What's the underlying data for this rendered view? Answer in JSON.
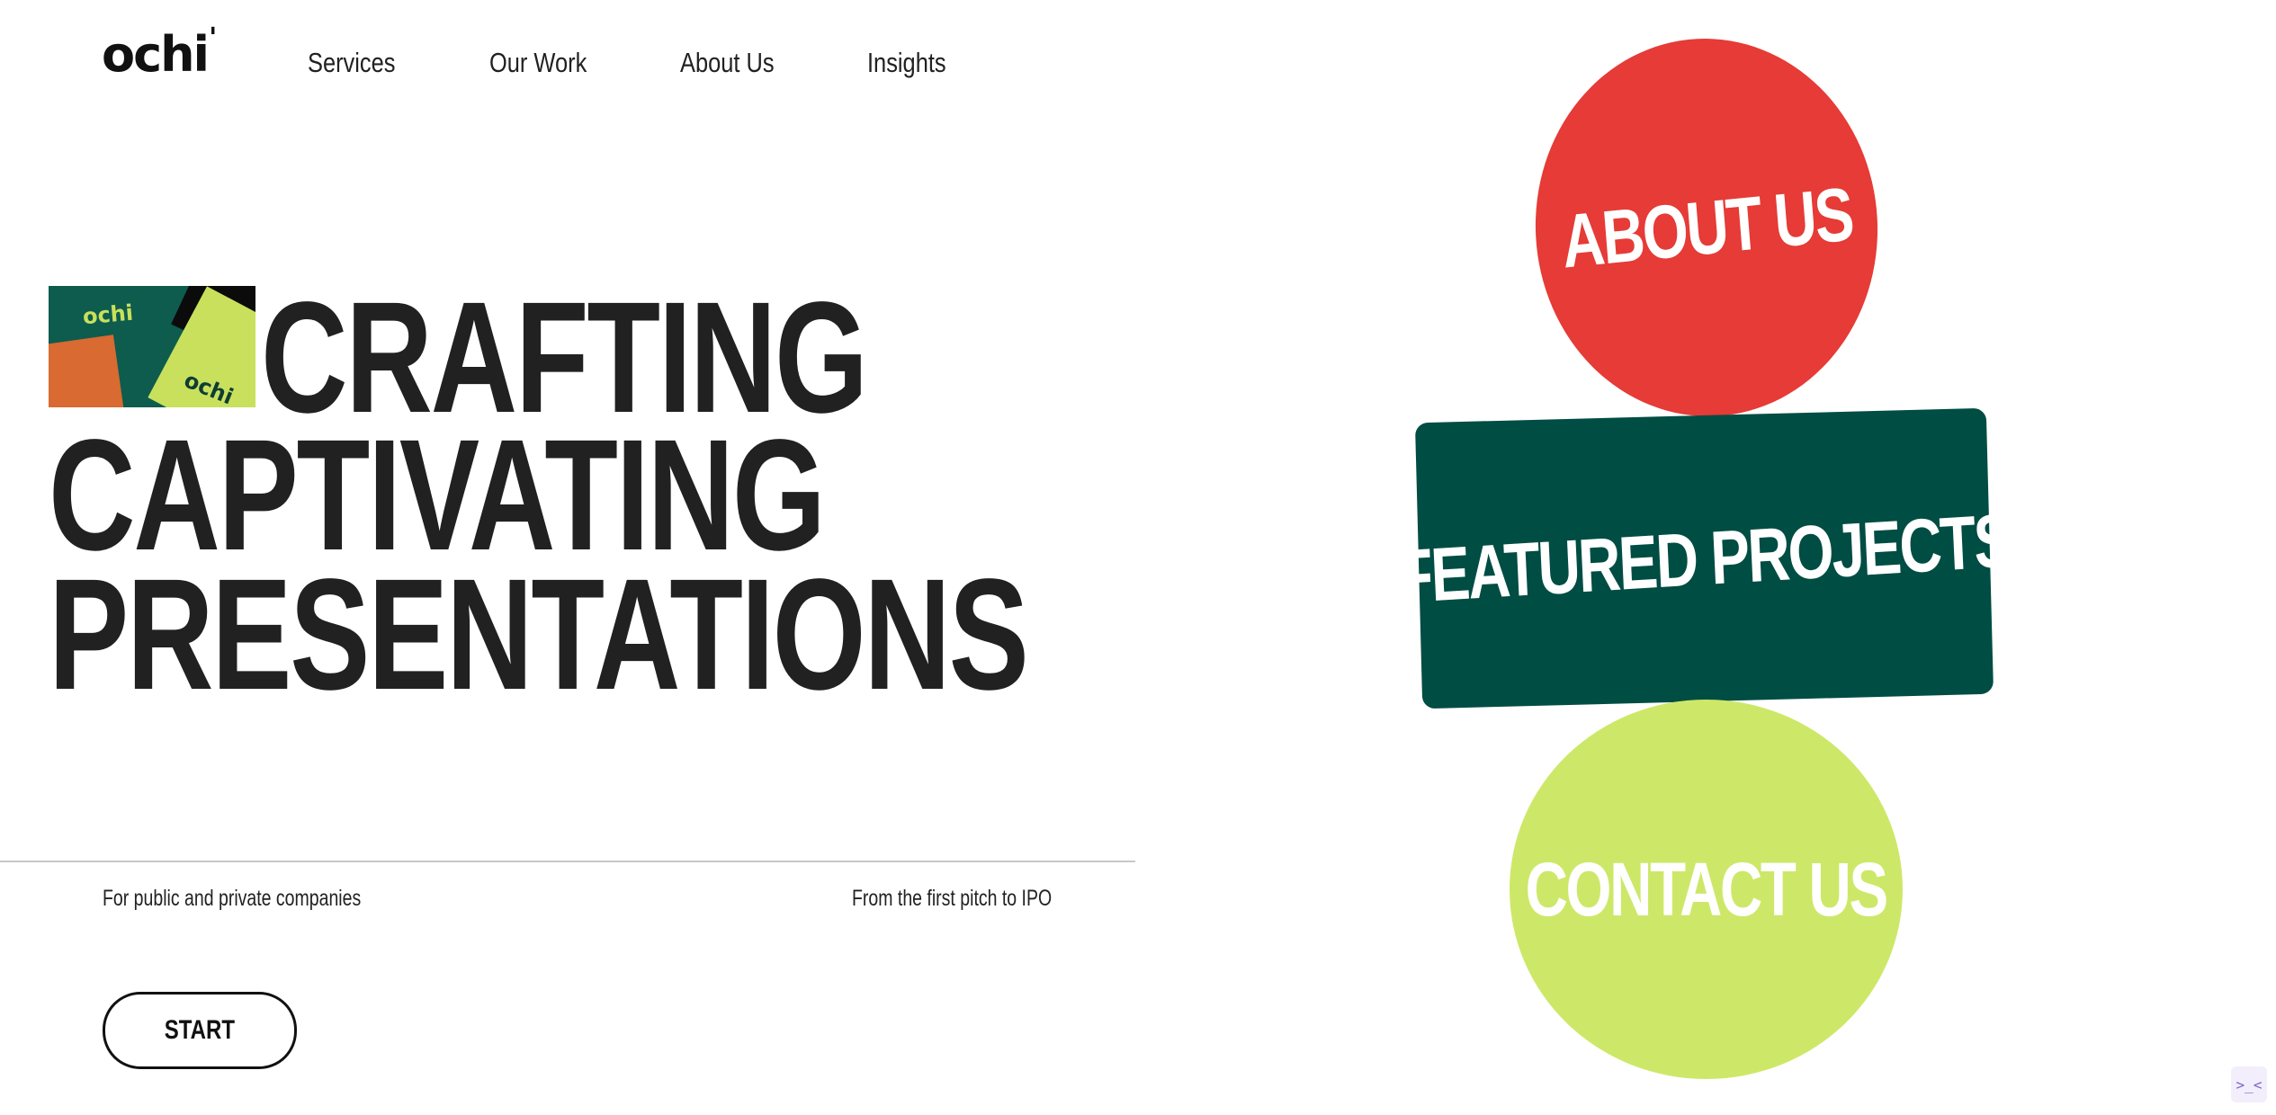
{
  "brand": {
    "logo_text": "ochi",
    "logo_tick": "'"
  },
  "nav": {
    "items": [
      {
        "label": "Services"
      },
      {
        "label": "Our Work"
      },
      {
        "label": "About Us"
      },
      {
        "label": "Insights"
      }
    ]
  },
  "hero": {
    "thumbnail": {
      "mark_top": "ochi",
      "mark_bottom": "ochi"
    },
    "headline": [
      "CRAFTING",
      "CAPTIVATING",
      "PRESENTATIONS"
    ],
    "sub_left": "For public and private companies",
    "sub_right": "From the first pitch to IPO",
    "start_label": "START"
  },
  "cta": {
    "about": {
      "label": "ABOUT US",
      "color": "#e63b36"
    },
    "featured": {
      "label": "FEATURED PROJECTS",
      "color": "#004d43"
    },
    "contact": {
      "label": "CONTACT US",
      "color": "#cde868"
    }
  },
  "widget": {
    "icon": "code-chevron-icon",
    "glyph": ">_<"
  }
}
